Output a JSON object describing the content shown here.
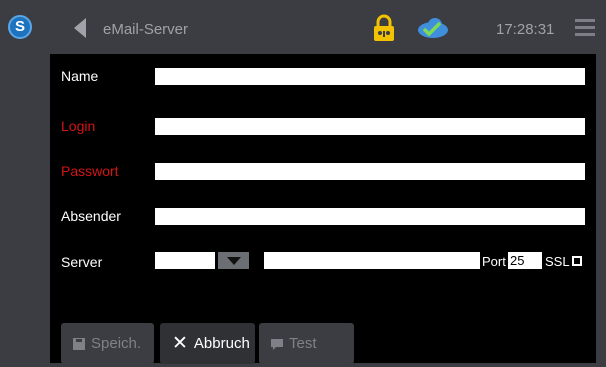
{
  "header": {
    "title": "eMail-Server",
    "time": "17:28:31"
  },
  "form": {
    "name_label": "Name",
    "login_label": "Login",
    "password_label": "Passwort",
    "sender_label": "Absender",
    "server_label": "Server",
    "port_label": "Port",
    "port_value": "25",
    "ssl_label": "SSL"
  },
  "buttons": {
    "save": "Speich.",
    "cancel": "Abbruch",
    "test": "Test"
  },
  "colors": {
    "bar": "#3b3d42",
    "required_label": "#d21515",
    "accent_blue": "#1e73be",
    "lock_yellow": "#f2c200"
  }
}
